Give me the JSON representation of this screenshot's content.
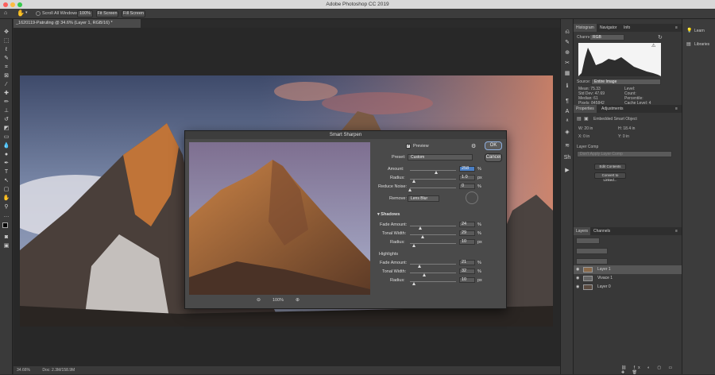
{
  "window": {
    "title": "Adobe Photoshop CC 2019"
  },
  "options_bar": {
    "scroll_all": "Scroll All Windows",
    "zoom_100": "100%",
    "fit_screen": "Fit Screen",
    "fill_screen": "Fill Screen"
  },
  "document": {
    "tab": "_1620119-Patruling @ 34.6% (Layer 1, RGB/16) *",
    "zoom": "34.66%",
    "doc_size": "Doc: 2.3M/158.9M"
  },
  "histogram_panel": {
    "tabs": [
      "Histogram",
      "Navigator",
      "Info"
    ],
    "channel_label": "Channel:",
    "channel_value": "RGB",
    "source_label": "Source:",
    "source_value": "Entire Image",
    "stats_left": [
      "Mean: 75.33",
      "Std Dev: 47.69",
      "Median: 61",
      "Pixels: 845842"
    ],
    "stats_right": [
      "Level:",
      "Count:",
      "Percentile:",
      "Cache Level: 4"
    ]
  },
  "properties_panel": {
    "tabs": [
      "Properties",
      "Adjustments"
    ],
    "embedded": "Embedded Smart Object",
    "w": "W: 20 in",
    "h": "H: 18.4 in",
    "x": "X: 0 in",
    "y": "Y: 0 in",
    "layer_comp_label": "Layer Comp",
    "layer_comp_value": "Don't Apply Layer Comp",
    "edit_contents": "Edit Contents",
    "convert_linked": "Convert to Linked..."
  },
  "layers_panel": {
    "tabs": [
      "Layers",
      "Channels"
    ],
    "layers": [
      {
        "name": "Layer 1"
      },
      {
        "name": "Vivace 1"
      },
      {
        "name": "Layer 0"
      }
    ]
  },
  "right_col": {
    "learn": "Learn",
    "libraries": "Libraries"
  },
  "dialog": {
    "title": "Smart Sharpen",
    "ok": "OK",
    "cancel": "Cancel",
    "preview_label": "Preview",
    "preset_label": "Preset:",
    "preset_value": "Custom",
    "amount_label": "Amount:",
    "amount_value": "258",
    "amount_unit": "%",
    "amount_pos": 0.58,
    "radius_label": "Radius:",
    "radius_value": "1.0",
    "radius_unit": "px",
    "radius_pos": 0.1,
    "noise_label": "Reduce Noise:",
    "noise_value": "0",
    "noise_unit": "%",
    "noise_pos": 0.0,
    "remove_label": "Remove:",
    "remove_value": "Lens Blur",
    "shadows_label": "Shadows",
    "highlights_label": "Highlights",
    "shadows_fade_label": "Fade Amount:",
    "shadows_fade_value": "24",
    "shadows_fade_pos": 0.24,
    "shadows_tonal_label": "Tonal Width:",
    "shadows_tonal_value": "29",
    "shadows_tonal_pos": 0.29,
    "shadows_radius_label": "Radius:",
    "shadows_radius_value": "10",
    "shadows_radius_pos": 0.1,
    "high_fade_label": "Fade Amount:",
    "high_fade_value": "21",
    "high_fade_pos": 0.21,
    "high_tonal_label": "Tonal Width:",
    "high_tonal_value": "32",
    "high_tonal_pos": 0.32,
    "high_radius_label": "Radius:",
    "high_radius_value": "10",
    "high_radius_pos": 0.1,
    "pct": "%",
    "px": "px",
    "zoom_value": "100%"
  }
}
